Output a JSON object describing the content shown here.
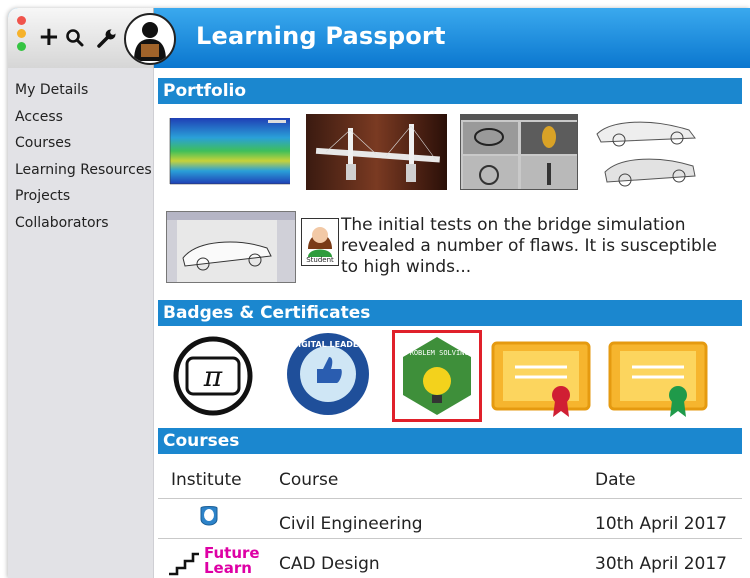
{
  "app": {
    "title": "Learning Passport"
  },
  "toolbar": {
    "icons": [
      "plus-icon",
      "search-icon",
      "wrench-icon",
      "user-avatar"
    ],
    "traffic_colors": [
      "#f0544c",
      "#f6b22b",
      "#35c442"
    ]
  },
  "sidebar": {
    "items": [
      {
        "label": "My Details"
      },
      {
        "label": "Access"
      },
      {
        "label": "Courses"
      },
      {
        "label": "Learning Resources"
      },
      {
        "label": "Projects"
      },
      {
        "label": "Collaborators"
      }
    ]
  },
  "portfolio": {
    "header": "Portfolio",
    "note": "The initial tests on the bridge simulation revealed a number of flaws. It is susceptible to high winds...",
    "note_avatar_label": "Student",
    "thumbs": [
      "heatmap-plot",
      "bridge-model",
      "cad-ring-views",
      "car-sketch",
      "car-cad-drawing"
    ]
  },
  "badges": {
    "header": "Badges & Certificates",
    "items": [
      {
        "name": "pi-badge",
        "label": "π"
      },
      {
        "name": "digital-leader-badge",
        "label": "DIGITAL LEADER"
      },
      {
        "name": "problem-solving-badge",
        "label": "PROBLEM SOLVING",
        "selected": true
      },
      {
        "name": "certificate-red",
        "label": ""
      },
      {
        "name": "certificate-green",
        "label": ""
      }
    ]
  },
  "courses": {
    "header": "Courses",
    "columns": [
      "Institute",
      "Course",
      "Date"
    ],
    "rows": [
      {
        "institute": "open-university-logo",
        "course": "Civil Engineering",
        "date": "10th April 2017"
      },
      {
        "institute": "Future Learn",
        "course": "CAD Design",
        "date": "30th April 2017"
      }
    ]
  },
  "colors": {
    "accent": "#1b87cf",
    "selected_border": "#e0202a"
  }
}
